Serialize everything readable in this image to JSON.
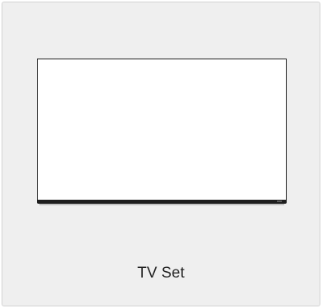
{
  "product": {
    "label": "TV Set",
    "icon": "tv-icon"
  },
  "colors": {
    "card_background": "#efefef",
    "card_border": "#d2d2d2",
    "screen_fill": "#ffffff",
    "tv_outline": "#1b1b1b",
    "text": "#222222"
  }
}
